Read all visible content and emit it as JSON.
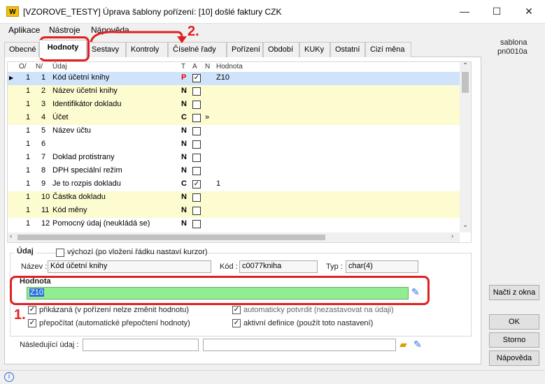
{
  "window": {
    "title": "[VZOROVE_TESTY] Úprava šablony pořízení: [10] došlé faktury CZK",
    "logo": "W",
    "controls": {
      "minimize": "—",
      "maximize": "☐",
      "close": "✕"
    }
  },
  "menu": [
    "Aplikace",
    "Nástroje",
    "Nápověda"
  ],
  "tabs": [
    "Obecné",
    "Hodnoty",
    "Sestavy",
    "Kontroly",
    "Číselné řady",
    "Pořízení",
    "Období",
    "KUKy",
    "Ostatní",
    "Cizí měna"
  ],
  "active_tab": "Hodnoty",
  "side_info": {
    "line1": "sablona",
    "line2": "pn0010a"
  },
  "grid": {
    "headers": {
      "oi": "O/",
      "ni": "N/",
      "udaj": "Údaj",
      "t": "T",
      "a": "A",
      "n": "N",
      "hodnota": "Hodnota"
    },
    "rows": [
      {
        "o": "1",
        "n": "1",
        "udaj": "Kód účetní knihy",
        "t": "P",
        "a": true,
        "extra": "",
        "hodnota": "Z10",
        "style": "selected"
      },
      {
        "o": "1",
        "n": "2",
        "udaj": "Název účetní knihy",
        "t": "N",
        "a": false,
        "extra": "",
        "hodnota": "",
        "style": "yellow"
      },
      {
        "o": "1",
        "n": "3",
        "udaj": "Identifikátor dokladu",
        "t": "N",
        "a": false,
        "extra": "",
        "hodnota": "",
        "style": "yellow"
      },
      {
        "o": "1",
        "n": "4",
        "udaj": "Účet",
        "t": "C",
        "a": false,
        "extra": "»",
        "hodnota": "",
        "style": "yellow"
      },
      {
        "o": "1",
        "n": "5",
        "udaj": "Název účtu",
        "t": "N",
        "a": false,
        "extra": "",
        "hodnota": "",
        "style": "white"
      },
      {
        "o": "1",
        "n": "6",
        "udaj": "",
        "t": "N",
        "a": false,
        "extra": "",
        "hodnota": "",
        "style": "white"
      },
      {
        "o": "1",
        "n": "7",
        "udaj": "Doklad protistrany",
        "t": "N",
        "a": false,
        "extra": "",
        "hodnota": "",
        "style": "white"
      },
      {
        "o": "1",
        "n": "8",
        "udaj": "DPH speciální režim",
        "t": "N",
        "a": false,
        "extra": "",
        "hodnota": "",
        "style": "white"
      },
      {
        "o": "1",
        "n": "9",
        "udaj": "Je to rozpis dokladu",
        "t": "C",
        "a": true,
        "extra": "",
        "hodnota": "1",
        "style": "white"
      },
      {
        "o": "1",
        "n": "10",
        "udaj": "Částka dokladu",
        "t": "N",
        "a": false,
        "extra": "",
        "hodnota": "",
        "style": "yellow"
      },
      {
        "o": "1",
        "n": "11",
        "udaj": "Kód měny",
        "t": "N",
        "a": false,
        "extra": "",
        "hodnota": "",
        "style": "yellow"
      },
      {
        "o": "1",
        "n": "12",
        "udaj": "Pomocný údaj (neukládá se)",
        "t": "N",
        "a": false,
        "extra": "",
        "hodnota": "",
        "style": "white"
      }
    ]
  },
  "detail": {
    "group_label": "Údaj",
    "default_checkbox": "výchozí (po vložení řádku nastaví kurzor)",
    "nazev_label": "Název :",
    "nazev_value": "Kód účetní knihy",
    "kod_label": "Kód :",
    "kod_value": "c0077kniha",
    "typ_label": "Typ :",
    "typ_value": "char(4)",
    "hodnota_label": "Hodnota",
    "hodnota_value": "Z10",
    "options": [
      {
        "label": "přikázaná (v pořízení nelze změnit hodnotu)",
        "checked": true
      },
      {
        "label": "automaticky potvrdit (nezastavovat na údaji)",
        "checked": true
      },
      {
        "label": "přepočítat (automatické přepočtení hodnoty)",
        "checked": true
      },
      {
        "label": "aktivní definice (použít toto nastavení)",
        "checked": true
      }
    ],
    "next_label": "Následující údaj :"
  },
  "buttons": {
    "load": "Načti z okna",
    "ok": "OK",
    "cancel": "Storno",
    "help": "Nápověda"
  },
  "annotations": {
    "one": "1.",
    "two": "2."
  },
  "colors": {
    "highlight_green": "#90ee90",
    "selected_row": "#cfe3fa",
    "yellow_row": "#fdfbd0",
    "annotation_red": "#e02020"
  }
}
